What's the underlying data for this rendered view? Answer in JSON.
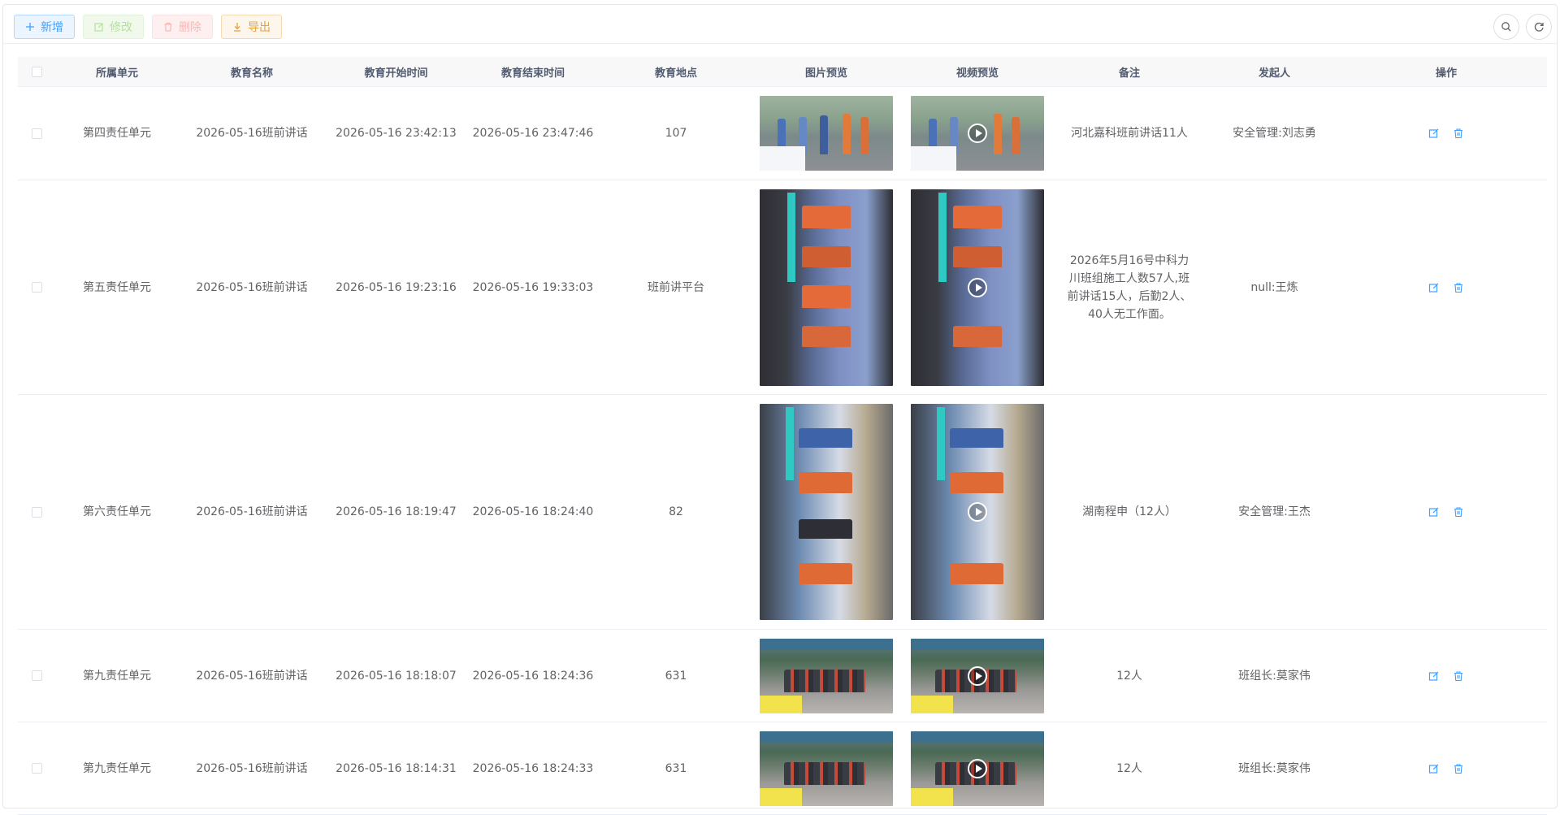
{
  "toolbar": {
    "add_label": "新增",
    "edit_label": "修改",
    "delete_label": "删除",
    "export_label": "导出"
  },
  "table": {
    "columns": [
      "所属单元",
      "教育名称",
      "教育开始时间",
      "教育结束时间",
      "教育地点",
      "图片预览",
      "视频预览",
      "备注",
      "发起人",
      "操作"
    ],
    "rows": [
      {
        "unit": "第四责任单元",
        "name": "2026-05-16班前讲话",
        "start": "2026-05-16 23:42:13",
        "end": "2026-05-16 23:47:46",
        "place": "107",
        "remark": "河北嘉科班前讲话11人",
        "initiator": "安全管理:刘志勇"
      },
      {
        "unit": "第五责任单元",
        "name": "2026-05-16班前讲话",
        "start": "2026-05-16 19:23:16",
        "end": "2026-05-16 19:33:03",
        "place": "班前讲平台",
        "remark": "2026年5月16号中科力川班组施工人数57人,班前讲话15人，后勤2人、40人无工作面。",
        "initiator": "null:王炼"
      },
      {
        "unit": "第六责任单元",
        "name": "2026-05-16班前讲话",
        "start": "2026-05-16 18:19:47",
        "end": "2026-05-16 18:24:40",
        "place": "82",
        "remark": "湖南程申（12人）",
        "initiator": "安全管理:王杰"
      },
      {
        "unit": "第九责任单元",
        "name": "2026-05-16班前讲话",
        "start": "2026-05-16 18:18:07",
        "end": "2026-05-16 18:24:36",
        "place": "631",
        "remark": "12人",
        "initiator": "班组长:莫家伟"
      },
      {
        "unit": "第九责任单元",
        "name": "2026-05-16班前讲话",
        "start": "2026-05-16 18:14:31",
        "end": "2026-05-16 18:24:33",
        "place": "631",
        "remark": "12人",
        "initiator": "班组长:莫家伟"
      }
    ]
  },
  "icons": {
    "add": "plus-icon",
    "edit": "edit-icon",
    "delete": "trash-icon",
    "export": "download-icon",
    "search": "search-icon",
    "refresh": "refresh-icon"
  },
  "colors": {
    "primary": "#409eff",
    "success": "#67c23a",
    "danger": "#f56c6c",
    "warning": "#e6a23c"
  }
}
